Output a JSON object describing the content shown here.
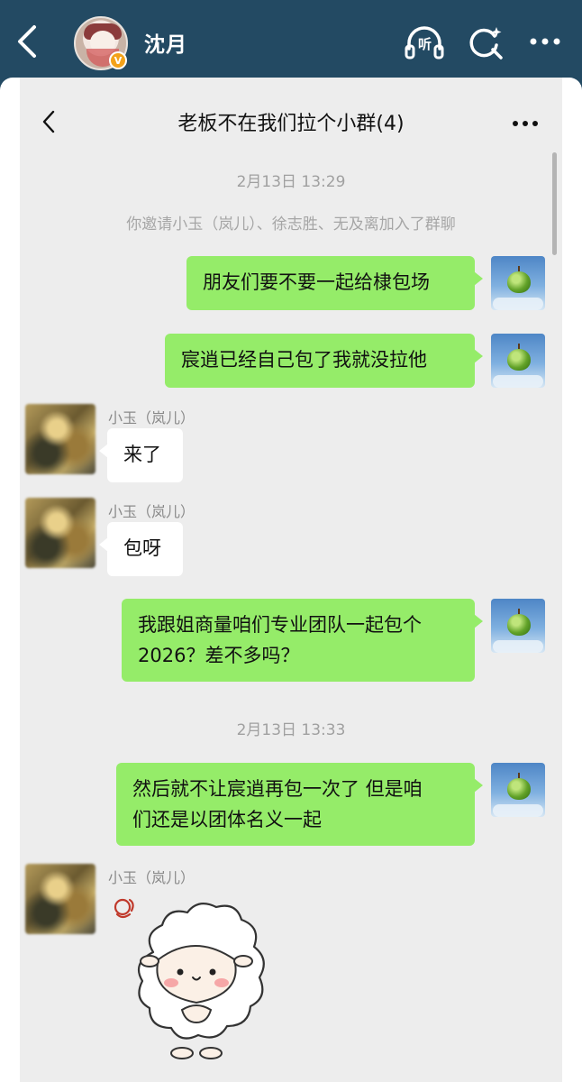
{
  "outer": {
    "contact_name": "沈月",
    "badge": "V",
    "listen_label": "听"
  },
  "chat": {
    "title": "老板不在我们拉个小群(4)",
    "messages": [
      {
        "type": "time",
        "text": "2月13日 13:29"
      },
      {
        "type": "system",
        "text": "你邀请小玉（岚儿）、徐志胜、无及离加入了群聊"
      },
      {
        "type": "out",
        "text": "朋友们要不要一起给棣包场"
      },
      {
        "type": "out",
        "text": "宸逍已经自己包了我就没拉他"
      },
      {
        "type": "in",
        "sender": "小玉（岚儿）",
        "text": "来了"
      },
      {
        "type": "in",
        "sender": "小玉（岚儿）",
        "text": "包呀"
      },
      {
        "type": "out",
        "lines": [
          "我跟姐商量咱们专业团队一起包个",
          "2026？差不多吗？"
        ]
      },
      {
        "type": "time",
        "text": "2月13日 13:33"
      },
      {
        "type": "out",
        "lines": [
          "然后就不让宸逍再包一次了 但是咱",
          "们还是以团体名义一起"
        ]
      },
      {
        "type": "in",
        "sender": "小玉（岚儿）",
        "sticker": "sheep-sticker"
      }
    ]
  },
  "colors": {
    "topbar": "#234a63",
    "chat_bg": "#ededed",
    "bubble_out": "#95ec69",
    "bubble_in": "#ffffff"
  }
}
